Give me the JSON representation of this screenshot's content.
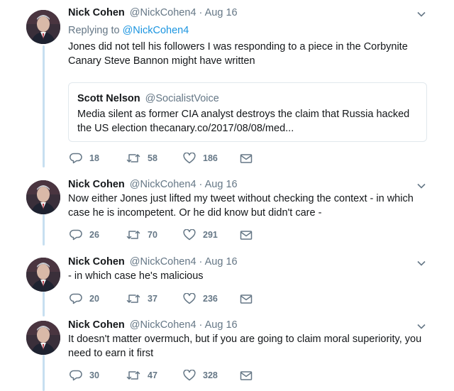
{
  "tweets": [
    {
      "name": "Nick Cohen",
      "handle": "@NickCohen4",
      "separator": "·",
      "time": "Aug 16",
      "replying_prefix": "Replying to",
      "replying_to": "@NickCohen4",
      "text": "Jones did not tell his followers I was responding to a piece in the Corbynite Canary Steve Bannon might have written",
      "quote": {
        "name": "Scott Nelson",
        "handle": "@SocialistVoice",
        "text": "Media silent as former CIA analyst destroys the claim that Russia hacked the US election thecanary.co/2017/08/08/med..."
      },
      "replies": "18",
      "retweets": "58",
      "likes": "186"
    },
    {
      "name": "Nick Cohen",
      "handle": "@NickCohen4",
      "separator": "·",
      "time": "Aug 16",
      "text": "Now either Jones just lifted my tweet without checking the context - in which case he is incompetent. Or he did know but didn't care -",
      "replies": "26",
      "retweets": "70",
      "likes": "291"
    },
    {
      "name": "Nick Cohen",
      "handle": "@NickCohen4",
      "separator": "·",
      "time": "Aug 16",
      "text": "- in which case he's malicious",
      "replies": "20",
      "retweets": "37",
      "likes": "236"
    },
    {
      "name": "Nick Cohen",
      "handle": "@NickCohen4",
      "separator": "·",
      "time": "Aug 16",
      "text": "It doesn't matter overmuch, but if you are going to claim moral superiority, you need to earn it first",
      "replies": "30",
      "retweets": "47",
      "likes": "328"
    }
  ],
  "colors": {
    "link": "#1b95e0",
    "muted": "#657786",
    "thread_line": "#c7dff0",
    "border": "#e1e8ed"
  },
  "icons": [
    "reply-icon",
    "retweet-icon",
    "like-icon",
    "message-icon",
    "chevron-down-icon"
  ]
}
